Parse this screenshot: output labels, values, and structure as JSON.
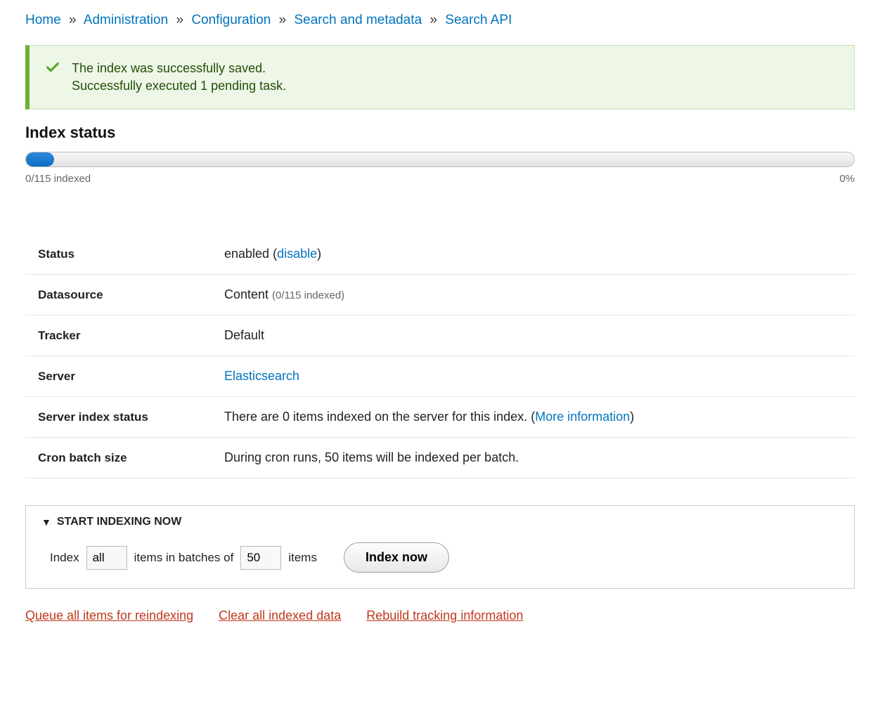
{
  "breadcrumb": {
    "home": "Home",
    "admin": "Administration",
    "config": "Configuration",
    "search_meta": "Search and metadata",
    "search_api": "Search API",
    "sep": "»"
  },
  "status_message": {
    "line1": "The index was successfully saved.",
    "line2": "Successfully executed 1 pending task."
  },
  "index_status": {
    "title": "Index status",
    "progress_label": "0/115 indexed",
    "percent": "0%"
  },
  "details": {
    "status": {
      "label": "Status",
      "value_prefix": "enabled (",
      "link": "disable",
      "value_suffix": ")"
    },
    "datasource": {
      "label": "Datasource",
      "value": "Content ",
      "note": "(0/115 indexed)"
    },
    "tracker": {
      "label": "Tracker",
      "value": "Default"
    },
    "server": {
      "label": "Server",
      "link": "Elasticsearch"
    },
    "server_index_status": {
      "label": "Server index status",
      "prefix": "There are 0 items indexed on the server for this index. (",
      "link": "More information",
      "suffix": ")"
    },
    "cron": {
      "label": "Cron batch size",
      "value": "During cron runs, 50 items will be indexed per batch."
    }
  },
  "indexing": {
    "legend": "START INDEXING NOW",
    "word_index": "Index",
    "field_all": "all",
    "mid": "items in batches of",
    "batch_size": "50",
    "word_items": "items",
    "button": "Index now"
  },
  "actions": {
    "queue": "Queue all items for reindexing",
    "clear": "Clear all indexed data",
    "rebuild": "Rebuild tracking information"
  }
}
